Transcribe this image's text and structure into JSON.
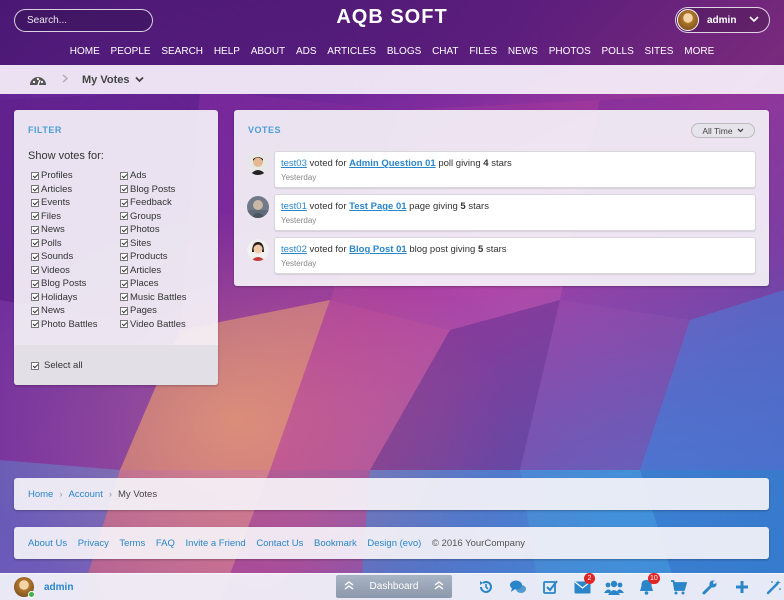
{
  "header": {
    "search_placeholder": "Search...",
    "site_title": "AQB SOFT",
    "user_name": "admin",
    "nav": [
      "HOME",
      "PEOPLE",
      "SEARCH",
      "HELP",
      "ABOUT",
      "ADS",
      "ARTICLES",
      "BLOGS",
      "CHAT",
      "FILES",
      "NEWS",
      "PHOTOS",
      "POLLS",
      "SITES",
      "MORE"
    ]
  },
  "subheader": {
    "page_menu_label": "My Votes"
  },
  "filter": {
    "title": "FILTER",
    "show_label": "Show votes for:",
    "items": [
      "Profiles",
      "Ads",
      "Articles",
      "Blog Posts",
      "Events",
      "Feedback",
      "Files",
      "Groups",
      "News",
      "Photos",
      "Polls",
      "Sites",
      "Sounds",
      "Products",
      "Videos",
      "Articles",
      "Blog Posts",
      "Places",
      "Holidays",
      "Music Battles",
      "News",
      "Pages",
      "Photo Battles",
      "Video Battles"
    ],
    "select_all": "Select all"
  },
  "votes": {
    "title": "VOTES",
    "period": "All Time",
    "items": [
      {
        "user": "test03",
        "verb": "voted for",
        "object": "Admin Question 01",
        "type_text": "poll giving",
        "stars": "4",
        "stars_word": "stars",
        "time": "Yesterday"
      },
      {
        "user": "test01",
        "verb": "voted for",
        "object": "Test Page 01",
        "type_text": "page giving",
        "stars": "5",
        "stars_word": "stars",
        "time": "Yesterday"
      },
      {
        "user": "test02",
        "verb": "voted for",
        "object": "Blog Post 01",
        "type_text": "blog post giving",
        "stars": "5",
        "stars_word": "stars",
        "time": "Yesterday"
      }
    ]
  },
  "breadcrumb": {
    "home": "Home",
    "account": "Account",
    "current": "My Votes"
  },
  "footer": {
    "links": [
      "About Us",
      "Privacy",
      "Terms",
      "FAQ",
      "Invite a Friend",
      "Contact Us",
      "Bookmark",
      "Design (evo)"
    ],
    "copyright": "© 2016 YourCompany"
  },
  "bottombar": {
    "user_name": "admin",
    "dashboard": "Dashboard",
    "mail_badge": "2",
    "notifications_badge": "10",
    "icons": [
      "history-icon",
      "chat-icon",
      "tasks-icon",
      "mail-icon",
      "friends-icon",
      "notifications-icon",
      "cart-icon",
      "tools-icon",
      "add-icon",
      "magic-wand-icon"
    ]
  },
  "colors": {
    "accent": "#2a86c8",
    "panel_title": "#4a9fd5",
    "badge": "#e02424"
  }
}
